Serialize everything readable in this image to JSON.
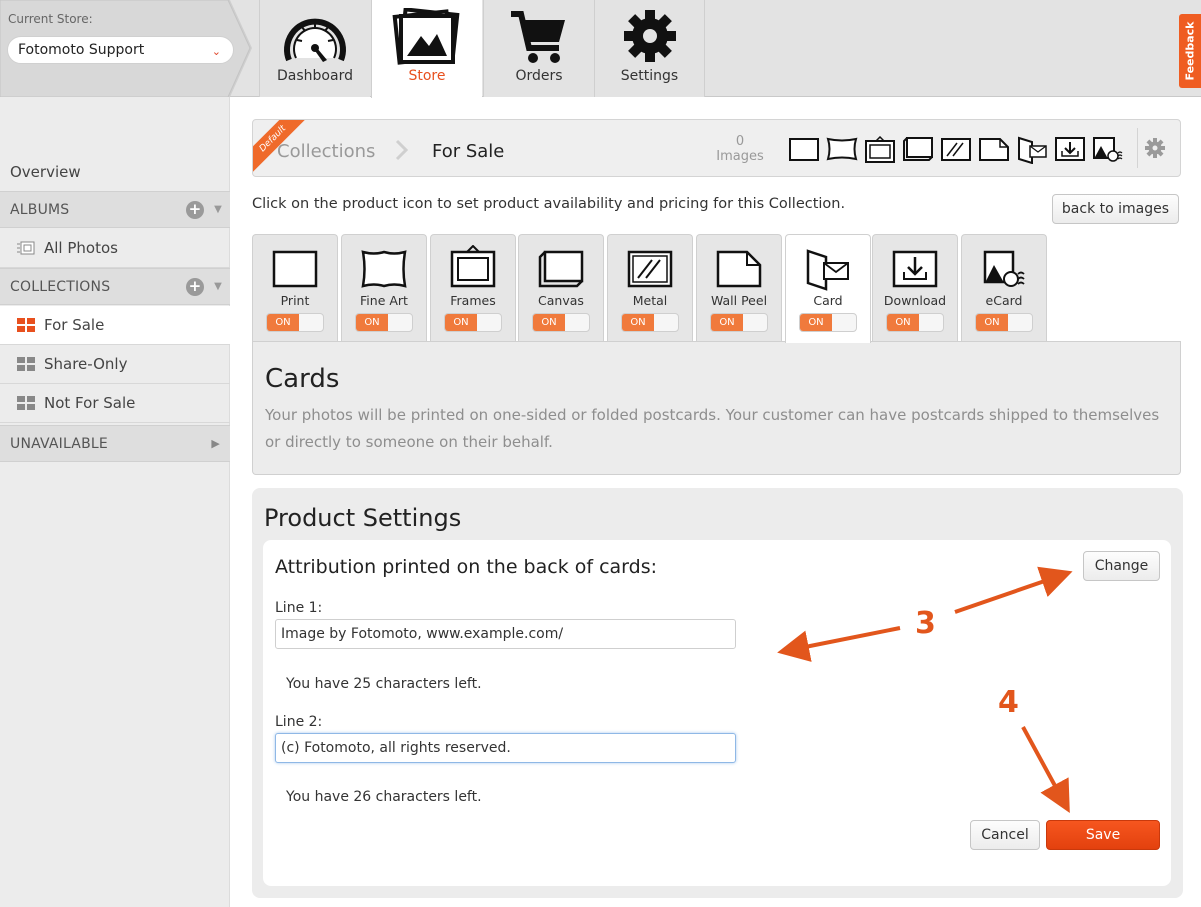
{
  "colors": {
    "accent": "#e8501e",
    "toggle_on": "#f07a3c",
    "save": "#ee4c16",
    "annotation": "#e2561c"
  },
  "store": {
    "label": "Current Store:",
    "value": "Fotomoto Support"
  },
  "nav": {
    "tabs": [
      {
        "label": "Dashboard",
        "icon": "dashboard-gauge-icon"
      },
      {
        "label": "Store",
        "icon": "photos-icon",
        "active": true
      },
      {
        "label": "Orders",
        "icon": "cart-icon"
      },
      {
        "label": "Settings",
        "icon": "gear-icon"
      }
    ],
    "feedback": "Feedback"
  },
  "sidebar": {
    "overview": "Overview",
    "albums_header": "ALBUMS",
    "all_photos": "All Photos",
    "collections_header": "COLLECTIONS",
    "collections": [
      {
        "label": "For Sale",
        "active": true
      },
      {
        "label": "Share-Only"
      },
      {
        "label": "Not For Sale"
      }
    ],
    "unavailable_header": "UNAVAILABLE"
  },
  "collection_bar": {
    "ribbon": "Default",
    "crumb": "Collections",
    "current": "For Sale",
    "image_count": "0",
    "image_count_label": "Images"
  },
  "instruction": "Click on the product icon to set product availability and pricing for this Collection.",
  "back_button": "back to images",
  "products": [
    {
      "label": "Print",
      "toggle": "ON",
      "icon": "print-icon"
    },
    {
      "label": "Fine Art",
      "toggle": "ON",
      "icon": "fine-art-icon"
    },
    {
      "label": "Frames",
      "toggle": "ON",
      "icon": "frame-icon"
    },
    {
      "label": "Canvas",
      "toggle": "ON",
      "icon": "canvas-icon"
    },
    {
      "label": "Metal",
      "toggle": "ON",
      "icon": "metal-icon"
    },
    {
      "label": "Wall Peel",
      "toggle": "ON",
      "icon": "wall-peel-icon"
    },
    {
      "label": "Card",
      "toggle": "ON",
      "icon": "card-icon",
      "active": true
    },
    {
      "label": "Download",
      "toggle": "ON",
      "icon": "download-icon"
    },
    {
      "label": "eCard",
      "toggle": "ON",
      "icon": "ecard-icon"
    }
  ],
  "product_desc": {
    "title": "Cards",
    "text": "Your photos will be printed on one-sided or folded postcards. Your customer can have postcards shipped to themselves or directly to someone on their behalf."
  },
  "settings": {
    "title": "Product Settings",
    "attr_title": "Attribution printed on the back of cards:",
    "change_button": "Change",
    "line1_label": "Line 1:",
    "line1_value": "Image by Fotomoto, www.example.com/",
    "line1_chars_left": "You have 25 characters left.",
    "line2_label": "Line 2:",
    "line2_value": "(c) Fotomoto, all rights reserved.",
    "line2_chars_left": "You have 26 characters left.",
    "cancel_button": "Cancel",
    "save_button": "Save"
  },
  "annotations": {
    "step3": "3",
    "step4": "4"
  }
}
